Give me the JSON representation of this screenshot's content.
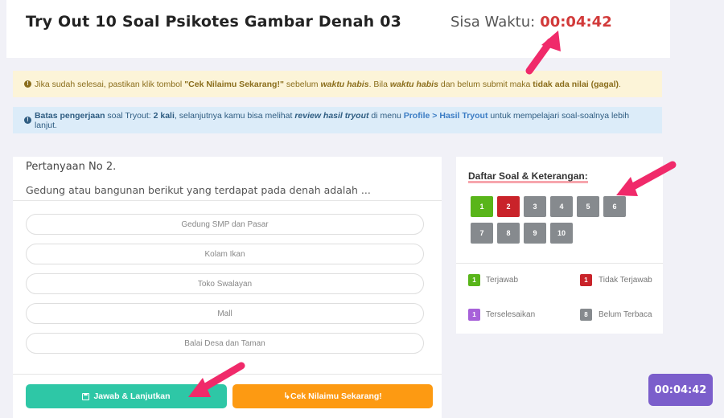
{
  "header": {
    "title": "Try Out 10 Soal Psikotes Gambar Denah 03",
    "timer_label": "Sisa Waktu:",
    "timer_value": "00:04:42"
  },
  "alerts": {
    "warning": {
      "p1": "Jika sudah selesai, pastikan klik tombol ",
      "p2": "\"Cek Nilaimu Sekarang!\"",
      "p3": " sebelum ",
      "p4": "waktu habis",
      "p5": ". Bila ",
      "p6": "waktu habis",
      "p7": " dan belum submit maka ",
      "p8": "tidak ada nilai (gagal)",
      "p9": "."
    },
    "info": {
      "p1": "Batas pengerjaan",
      "p2": " soal Tryout: ",
      "p3": "2 kali",
      "p4": ", selanjutnya kamu bisa melihat ",
      "p5": "review hasil tryout",
      "p6": " di menu ",
      "p7": "Profile > Hasil Tryout",
      "p8": " untuk mempelajari soal-soalnya lebih lanjut."
    }
  },
  "question": {
    "number_label": "Pertanyaan No 2.",
    "text": "Gedung atau bangunan berikut yang terdapat pada denah adalah ...",
    "options": [
      "Gedung SMP dan Pasar",
      "Kolam Ikan",
      "Toko Swalayan",
      "Mall",
      "Balai Desa dan Taman"
    ],
    "answer_button": "Jawab & Lanjutkan",
    "check_button": "Cek Nilaimu Sekarang!"
  },
  "sidebar": {
    "title": "Daftar Soal & Keterangan:",
    "numbers": [
      "1",
      "2",
      "3",
      "4",
      "5",
      "6",
      "7",
      "8",
      "9",
      "10"
    ],
    "statuses": [
      "answered",
      "unanswered",
      "unread",
      "unread",
      "unread",
      "unread",
      "unread",
      "unread",
      "unread",
      "unread"
    ],
    "legend": [
      {
        "sample": "1",
        "label": "Terjawab",
        "color": "#59b51a"
      },
      {
        "sample": "1",
        "label": "Tidak Terjawab",
        "color": "#c9232a"
      },
      {
        "sample": "1",
        "label": "Terselesaikan",
        "color": "#a761d9"
      },
      {
        "sample": "8",
        "label": "Belum Terbaca",
        "color": "#868a8e"
      }
    ]
  },
  "colors": {
    "answered": "#59b51a",
    "unanswered": "#c9232a",
    "unread": "#868a8e",
    "accent_arrow": "#f02a6a"
  },
  "float_timer": "00:04:42"
}
